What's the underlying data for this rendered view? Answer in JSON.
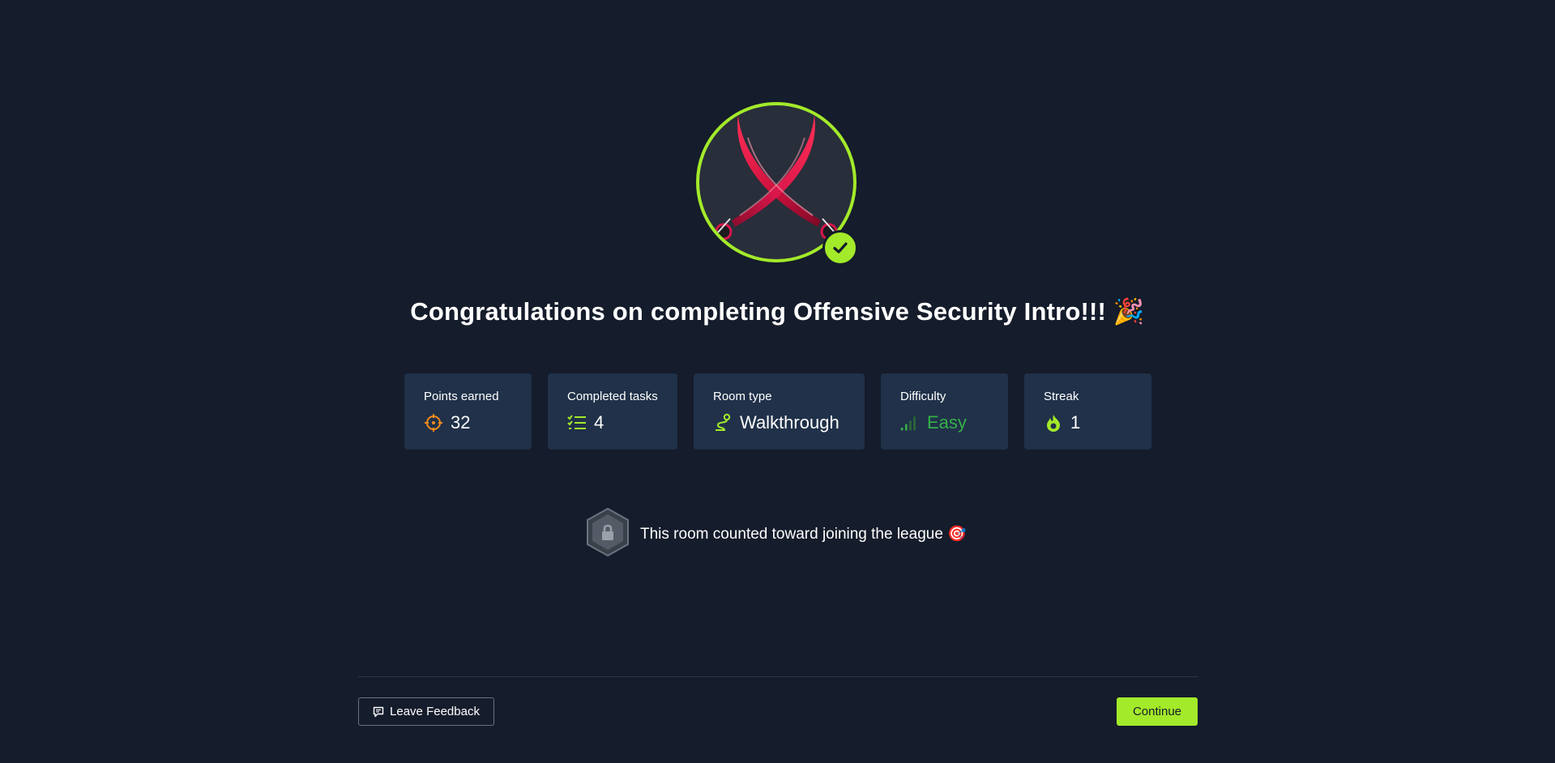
{
  "header": {
    "title": "Congratulations on completing Offensive Security Intro!!! 🎉"
  },
  "badge": {
    "icon": "crossed-swords-icon",
    "completed_icon": "check-icon",
    "ring_color": "#a3ea2a"
  },
  "stats": [
    {
      "label": "Points earned",
      "value": "32",
      "icon": "crosshair-icon",
      "icon_color": "#f38a1c"
    },
    {
      "label": "Completed tasks",
      "value": "4",
      "icon": "checklist-icon",
      "icon_color": "#a3ea2a"
    },
    {
      "label": "Room type",
      "value": "Walkthrough",
      "icon": "route-icon",
      "icon_color": "#a3ea2a"
    },
    {
      "label": "Difficulty",
      "value": "Easy",
      "icon": "signal-bars-icon",
      "icon_color": "#35b049"
    },
    {
      "label": "Streak",
      "value": "1",
      "icon": "flame-icon",
      "icon_color": "#a3ea2a"
    }
  ],
  "league": {
    "text": "This room counted toward joining the league 🎯",
    "icon": "locked-hexagon-icon"
  },
  "footer": {
    "feedback_label": "Leave Feedback",
    "continue_label": "Continue"
  },
  "colors": {
    "background": "#151c2b",
    "card": "#203149",
    "accent": "#a3ea2a",
    "easy": "#35b049"
  }
}
